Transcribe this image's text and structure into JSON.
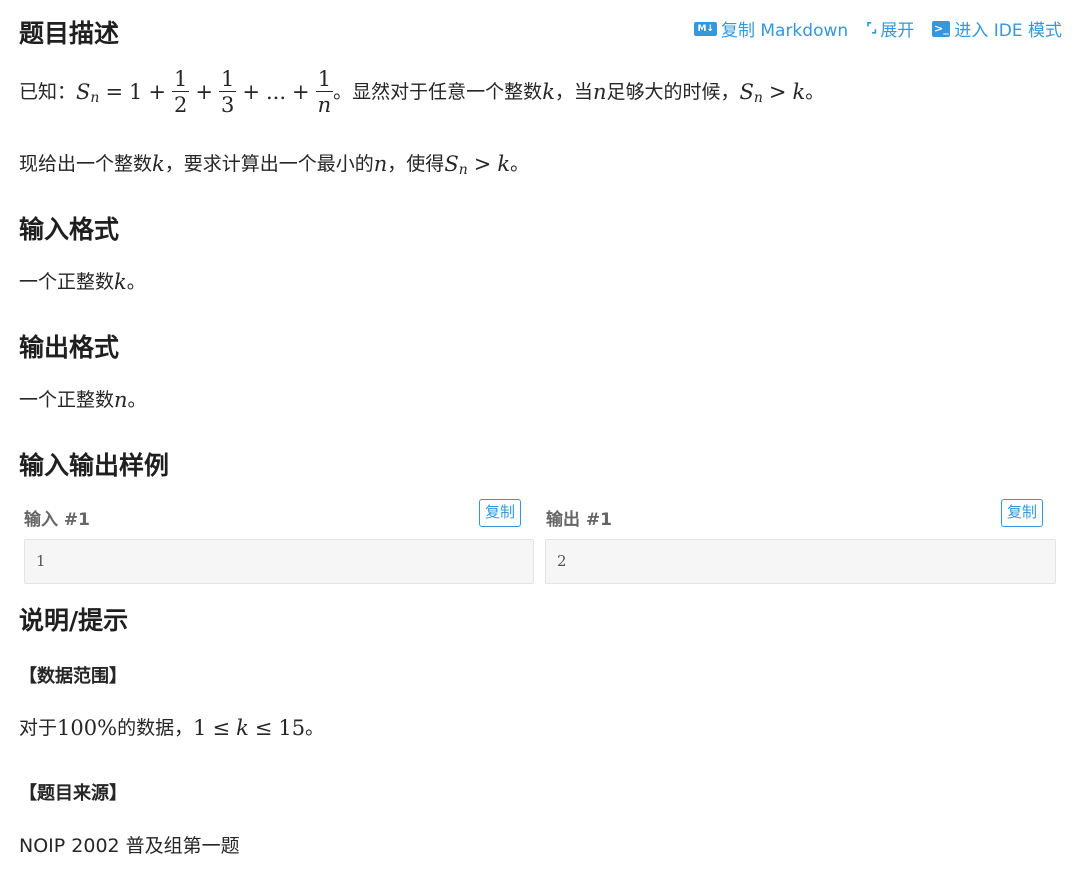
{
  "toolbar": {
    "copy_markdown": "复制 Markdown",
    "expand": "展开",
    "ide_mode": "进入 IDE 模式"
  },
  "description": {
    "title": "题目描述",
    "line1_prefix": "已知：",
    "line1_mid": "。显然对于任意一个整数 ",
    "line1_when": "，当 ",
    "line1_enough": " 足够大的时候，",
    "line1_end": "。",
    "line2_prefix": "现给出一个整数 ",
    "line2_mid": "，要求计算出一个最小的 ",
    "line2_make": "，使得 ",
    "line2_end": "。"
  },
  "math": {
    "S": "S",
    "n": "n",
    "k": "k",
    "eq": "=",
    "plus": "+",
    "gt": ">",
    "leq": "≤",
    "one": "1",
    "two": "2",
    "three": "3",
    "dots": "...",
    "hundred_pct": "100%",
    "fifteen": "15"
  },
  "input_format": {
    "title": "输入格式",
    "text_prefix": "一个正整数 ",
    "text_end": "。"
  },
  "output_format": {
    "title": "输出格式",
    "text_prefix": "一个正整数 ",
    "text_end": "。"
  },
  "samples": {
    "title": "输入输出样例",
    "input_label": "输入 #1",
    "output_label": "输出 #1",
    "copy_label": "复制",
    "input_value": "1",
    "output_value": "2"
  },
  "hint": {
    "title": "说明/提示",
    "range_heading": "【数据范围】",
    "range_prefix": "对于 ",
    "range_mid": " 的数据，",
    "range_end": "。",
    "source_heading": "【题目来源】",
    "source_text": "NOIP 2002 普及组第一题"
  },
  "colors": {
    "accent": "#3498db",
    "text": "#262626",
    "sample_bg": "#f6f6f6"
  }
}
